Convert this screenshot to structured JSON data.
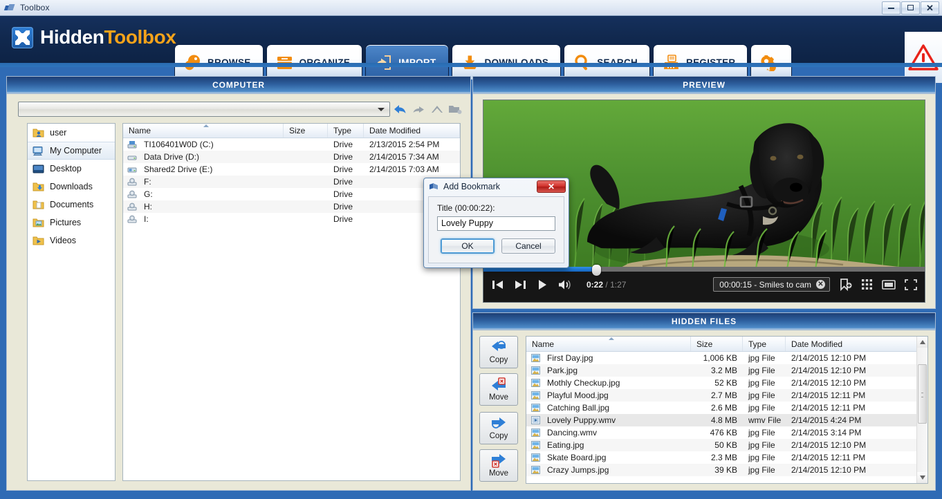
{
  "window": {
    "title": "Toolbox",
    "icon": "toolbox-app-icon",
    "minimize_label": "Minimize",
    "maximize_label": "Maximize",
    "close_label": "Close"
  },
  "brand": {
    "name_first": "Hidden",
    "name_second": "Toolbox",
    "logo_icon": "hidden-toolbox-logo"
  },
  "nav": {
    "tabs": [
      {
        "label": "BROWSE",
        "icon": "browse-icon",
        "active": false
      },
      {
        "label": "ORGANIZE",
        "icon": "organize-icon",
        "active": false
      },
      {
        "label": "IMPORT",
        "icon": "import-icon",
        "active": true
      },
      {
        "label": "DOWNLOADS",
        "icon": "downloads-icon",
        "active": false
      },
      {
        "label": "SEARCH",
        "icon": "search-icon",
        "active": false
      },
      {
        "label": "REGISTER",
        "icon": "register-icon",
        "active": false
      },
      {
        "label": "",
        "icon": "settings-gear-icon",
        "active": false
      }
    ],
    "alert_icon": "warning-triangle-icon"
  },
  "computer_panel": {
    "header": "COMPUTER",
    "address": {
      "value": "",
      "placeholder": ""
    },
    "nav_buttons": [
      {
        "name": "back-button",
        "icon": "arrow-back-icon",
        "enabled": true
      },
      {
        "name": "forward-button",
        "icon": "arrow-forward-icon",
        "enabled": false
      },
      {
        "name": "up-button",
        "icon": "arrow-up-icon",
        "enabled": false
      },
      {
        "name": "new-folder-button",
        "icon": "new-folder-icon",
        "enabled": false
      }
    ],
    "tree": [
      {
        "label": "user",
        "icon": "user-folder-icon",
        "selected": false
      },
      {
        "label": "My Computer",
        "icon": "my-computer-icon",
        "selected": true
      },
      {
        "label": "Desktop",
        "icon": "desktop-icon",
        "selected": false
      },
      {
        "label": "Downloads",
        "icon": "downloads-folder-icon",
        "selected": false
      },
      {
        "label": "Documents",
        "icon": "documents-folder-icon",
        "selected": false
      },
      {
        "label": "Pictures",
        "icon": "pictures-folder-icon",
        "selected": false
      },
      {
        "label": "Videos",
        "icon": "videos-folder-icon",
        "selected": false
      }
    ],
    "columns": [
      "Name",
      "Size",
      "Type",
      "Date Modified"
    ],
    "sorted_column": "Name",
    "rows": [
      {
        "name": "TI106401W0D (C:)",
        "size": "",
        "type": "Drive",
        "date": "2/13/2015 2:54 PM",
        "icon": "system-drive-icon"
      },
      {
        "name": "Data Drive (D:)",
        "size": "",
        "type": "Drive",
        "date": "2/14/2015 7:34 AM",
        "icon": "hard-drive-icon"
      },
      {
        "name": "Shared2 Drive (E:)",
        "size": "",
        "type": "Drive",
        "date": "2/14/2015 7:03 AM",
        "icon": "network-drive-icon"
      },
      {
        "name": "F:",
        "size": "",
        "type": "Drive",
        "date": "",
        "icon": "removable-drive-icon"
      },
      {
        "name": "G:",
        "size": "",
        "type": "Drive",
        "date": "",
        "icon": "removable-drive-icon"
      },
      {
        "name": "H:",
        "size": "",
        "type": "Drive",
        "date": "",
        "icon": "removable-drive-icon"
      },
      {
        "name": "I:",
        "size": "",
        "type": "Drive",
        "date": "",
        "icon": "removable-drive-icon"
      }
    ]
  },
  "preview_panel": {
    "header": "PREVIEW",
    "media": {
      "description": "black labrador puppy lying in green grass"
    },
    "player": {
      "current_time": "0:22",
      "separator": "/",
      "total_time": "1:27",
      "progress_percent": 25.5,
      "buttons": [
        {
          "name": "previous-button",
          "icon": "skip-previous-icon"
        },
        {
          "name": "next-button",
          "icon": "skip-next-icon"
        },
        {
          "name": "play-button",
          "icon": "play-icon"
        },
        {
          "name": "volume-button",
          "icon": "volume-icon"
        }
      ],
      "bookmark_chip": {
        "label": "00:00:15 - Smiles to cam",
        "clear_icon": "clear-circle-icon"
      },
      "right_buttons": [
        {
          "name": "add-bookmark-button",
          "icon": "add-bookmark-icon"
        },
        {
          "name": "thumbnails-button",
          "icon": "grid-icon"
        },
        {
          "name": "screen-size-button",
          "icon": "screen-icon"
        },
        {
          "name": "fullscreen-button",
          "icon": "fullscreen-icon"
        }
      ]
    }
  },
  "hidden_panel": {
    "header": "HIDDEN FILES",
    "side_buttons": [
      {
        "label": "Copy",
        "icon": "copy-in-icon",
        "name": "copy-in-button"
      },
      {
        "label": "Move",
        "icon": "move-in-icon",
        "name": "move-in-button"
      },
      {
        "label": "Copy",
        "icon": "copy-out-icon",
        "name": "copy-out-button"
      },
      {
        "label": "Move",
        "icon": "move-out-icon",
        "name": "move-out-button"
      }
    ],
    "columns": [
      "Name",
      "Size",
      "Type",
      "Date Modified"
    ],
    "sorted_column": "Name",
    "rows": [
      {
        "name": "First Day.jpg",
        "size": "1,006 KB",
        "type": "jpg File",
        "date": "2/14/2015 12:10 PM",
        "icon": "image-file-icon",
        "selected": false
      },
      {
        "name": "Park.jpg",
        "size": "3.2 MB",
        "type": "jpg File",
        "date": "2/14/2015 12:10 PM",
        "icon": "image-file-icon",
        "selected": false
      },
      {
        "name": "Mothly Checkup.jpg",
        "size": "52 KB",
        "type": "jpg File",
        "date": "2/14/2015 12:10 PM",
        "icon": "image-file-icon",
        "selected": false
      },
      {
        "name": "Playful Mood.jpg",
        "size": "2.7 MB",
        "type": "jpg File",
        "date": "2/14/2015 12:11 PM",
        "icon": "image-file-icon",
        "selected": false
      },
      {
        "name": "Catching Ball.jpg",
        "size": "2.6 MB",
        "type": "jpg File",
        "date": "2/14/2015 12:11 PM",
        "icon": "image-file-icon",
        "selected": false
      },
      {
        "name": "Lovely Puppy.wmv",
        "size": "4.8 MB",
        "type": "wmv File",
        "date": "2/14/2015 4:24 PM",
        "icon": "video-file-icon",
        "selected": true
      },
      {
        "name": "Dancing.wmv",
        "size": "476 KB",
        "type": "jpg File",
        "date": "2/14/2015 3:14 PM",
        "icon": "image-file-icon",
        "selected": false
      },
      {
        "name": "Eating.jpg",
        "size": "50 KB",
        "type": "jpg File",
        "date": "2/14/2015 12:10 PM",
        "icon": "image-file-icon",
        "selected": false
      },
      {
        "name": "Skate Board.jpg",
        "size": "2.3 MB",
        "type": "jpg File",
        "date": "2/14/2015 12:11 PM",
        "icon": "image-file-icon",
        "selected": false
      },
      {
        "name": "Crazy Jumps.jpg",
        "size": "39 KB",
        "type": "jpg File",
        "date": "2/14/2015 12:10 PM",
        "icon": "image-file-icon",
        "selected": false
      }
    ]
  },
  "dialog": {
    "title": "Add Bookmark",
    "icon": "bookmark-dialog-icon",
    "close_label": "✕",
    "field_label": "Title (00:00:22):",
    "field_value": "Lovely Puppy",
    "ok_label": "OK",
    "cancel_label": "Cancel"
  },
  "colors": {
    "app_background": "#2f6bb5",
    "header_navy": "#11294f",
    "brand_orange": "#f5a31a",
    "panel_header_blue": "#2d5f9e",
    "panel_body_beige": "#e9e8d8",
    "dialog_close_red": "#d0302a",
    "warning_red": "#e8231a",
    "seek_fill_blue": "#1565c0"
  }
}
